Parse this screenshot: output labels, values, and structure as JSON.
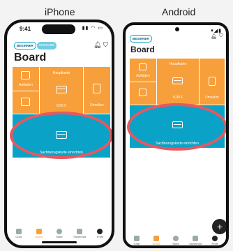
{
  "labels": {
    "iphone": "iPhone",
    "android": "Android"
  },
  "iphone": {
    "time": "9:41",
    "sys_icons": "▮▮ ◠ ▭",
    "badges": {
      "beginner": "BEGINNER",
      "upgrade": "UPGRADE"
    },
    "title": "Board",
    "tiles": {
      "aufladen": "Aufladen",
      "hauptkarte": "Hauptkarte",
      "amount": "0,00 €",
      "umsatze": "Umsätze",
      "sachbezug": "Sachbezugskarte einrichten"
    },
    "tabs": [
      "Chat",
      "Board",
      "Store",
      "Sicherheit",
      "Profil"
    ]
  },
  "android": {
    "sys_icons": "▾◢▮",
    "badges": {
      "beginner": "BEGINNER"
    },
    "title": "Board",
    "tiles": {
      "aufladen": "Aufladen",
      "hauptkarte": "Hauptkarte",
      "amount": "0,00 €",
      "umsatze": "Umsätze",
      "sachbezug": "Sachbezugskarte einrichten"
    },
    "tabs": [
      "Chat",
      "Board",
      "Store",
      "Sicherheit",
      "Profil"
    ],
    "fab": "+"
  },
  "colors": {
    "orange": "#f79f3b",
    "blue": "#0aa3c7",
    "highlight": "#e8585f"
  }
}
